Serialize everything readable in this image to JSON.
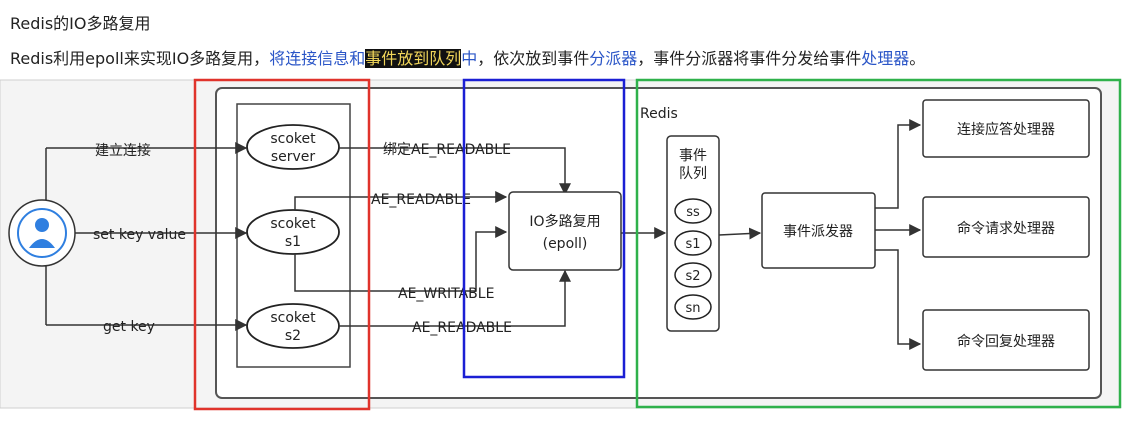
{
  "heading": "Redis的IO多路复用",
  "paragraph": {
    "p1": "Redis利用epoll来实现IO多路复用，",
    "p2_blue": "将连接信息和",
    "p3_highlight": "事件放到队列",
    "p4_blue": "中",
    "p5": "，依次放到事件",
    "p6_blue": "分派器",
    "p7": "，事件分派器将事件分发给事件",
    "p8_blue": "处理器",
    "p9": "。"
  },
  "diagram": {
    "client_labels": {
      "connect": "建立连接",
      "set": "set key value",
      "get": "get key"
    },
    "sockets": {
      "server_line1": "scoket",
      "server_line2": "server",
      "s1_line1": "scoket",
      "s1_line2": "s1",
      "s2_line1": "scoket",
      "s2_line2": "s2"
    },
    "edge_labels": {
      "bind_readable": "绑定AE_READABLE",
      "readable_s1": "AE_READABLE",
      "writable_s1": "AE_WRITABLE",
      "readable_s2": "AE_READABLE"
    },
    "epoll": {
      "line1": "IO多路复用",
      "line2": "(epoll)"
    },
    "redis_label": "Redis",
    "queue": {
      "title1": "事件",
      "title2": "队列",
      "items": [
        "ss",
        "s1",
        "s2",
        "sn"
      ]
    },
    "dispatcher": "事件派发器",
    "handlers": [
      "连接应答处理器",
      "命令请求处理器",
      "命令回复处理器"
    ],
    "colors": {
      "red_box": "#e0332b",
      "blue_box": "#1b1fd4",
      "green_box": "#2fb14b",
      "avatar": "#2f7fe0"
    }
  }
}
